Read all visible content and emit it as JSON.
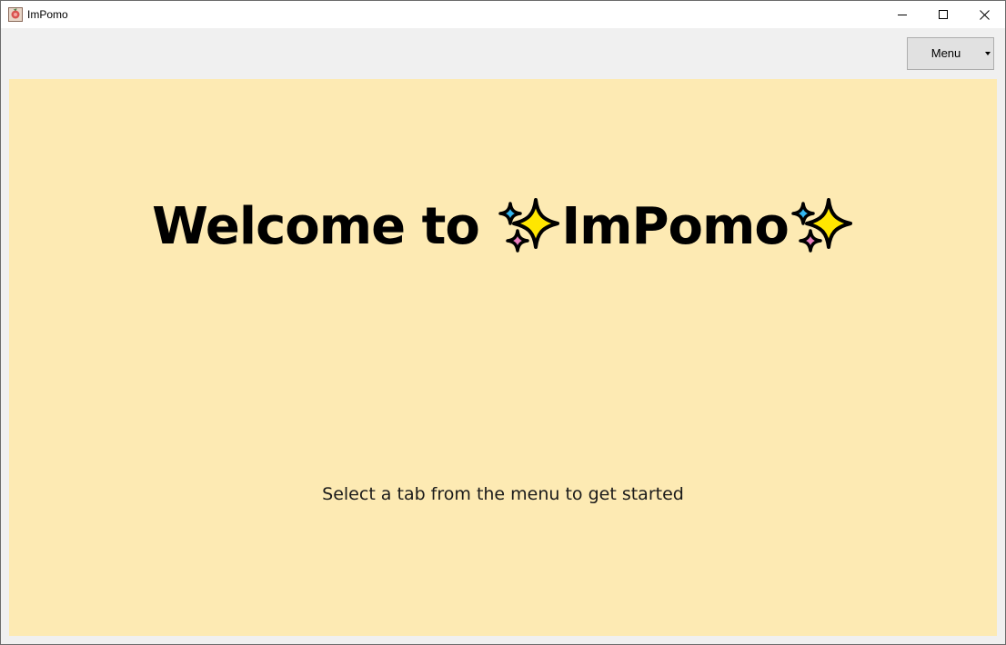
{
  "window": {
    "title": "ImPomo"
  },
  "toolbar": {
    "menu_label": "Menu"
  },
  "main": {
    "welcome_prefix": "Welcome to ",
    "app_name": "ImPomo",
    "subtitle": "Select a tab from the menu to get started"
  },
  "icons": {
    "sparkles": "sparkles-emoji"
  },
  "colors": {
    "content_bg": "#fdeab3",
    "sparkle_yellow": "#ffe600",
    "sparkle_blue": "#33b6f0",
    "sparkle_pink": "#ec80c0"
  }
}
